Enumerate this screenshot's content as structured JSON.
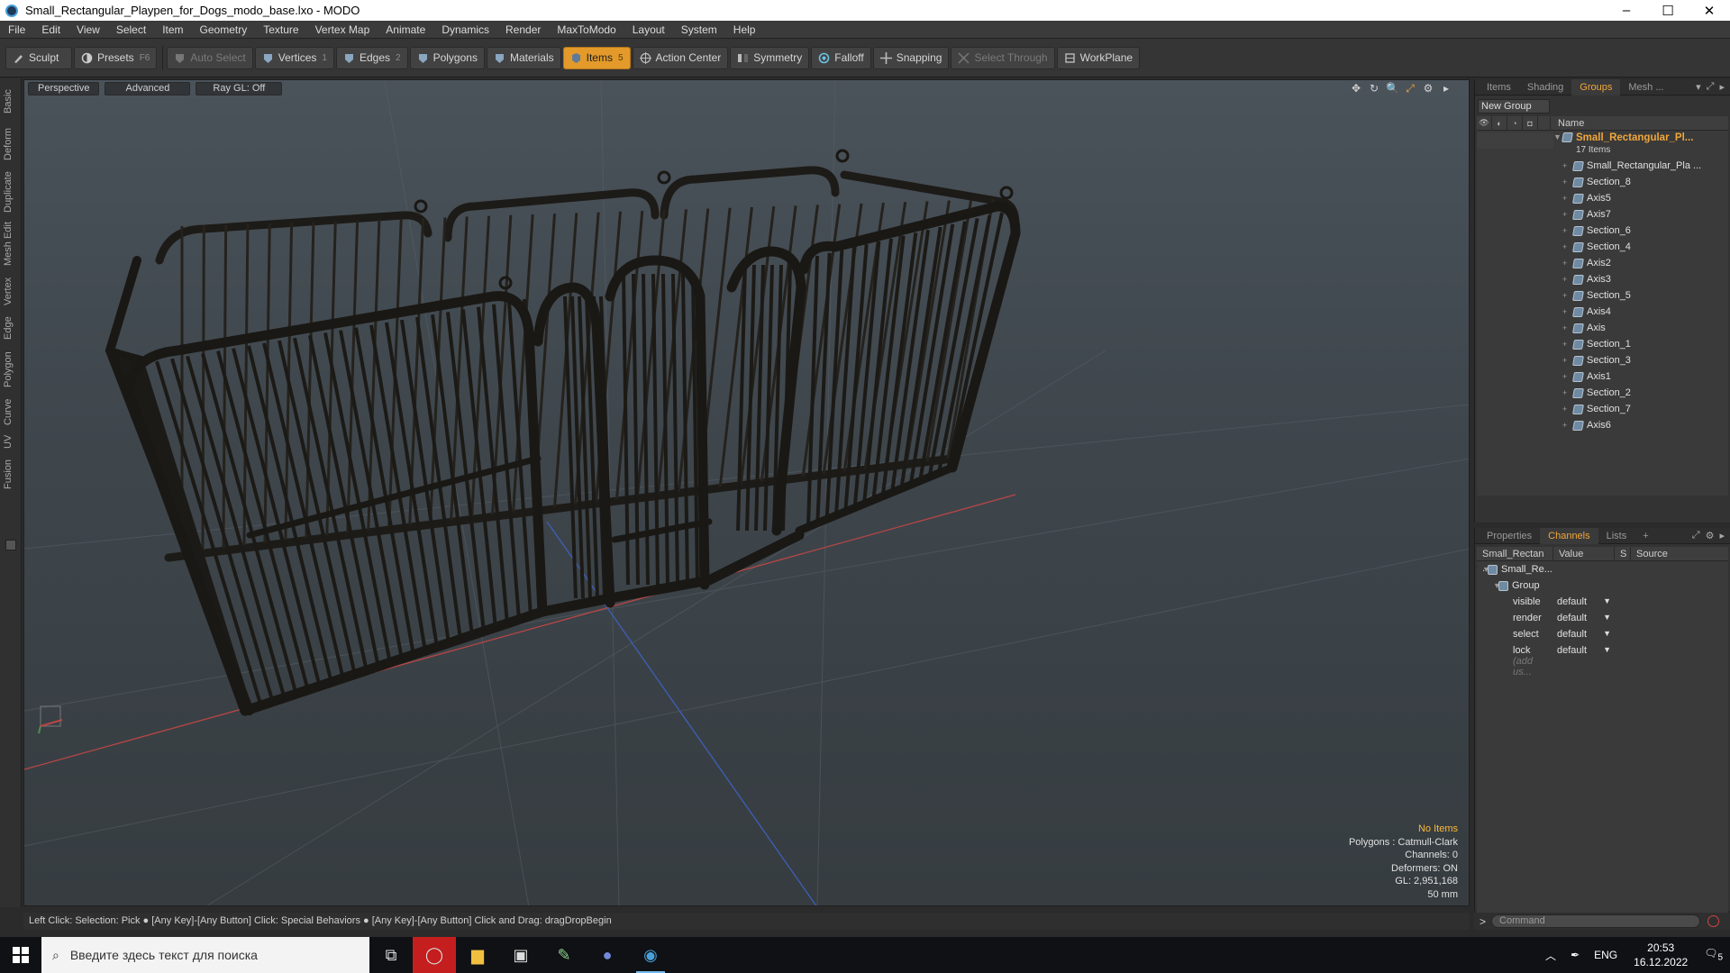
{
  "window": {
    "title": "Small_Rectangular_Playpen_for_Dogs_modo_base.lxo - MODO",
    "controls": [
      "–",
      "☐",
      "✕"
    ]
  },
  "menu": [
    "File",
    "Edit",
    "View",
    "Select",
    "Item",
    "Geometry",
    "Texture",
    "Vertex Map",
    "Animate",
    "Dynamics",
    "Render",
    "MaxToModo",
    "Layout",
    "System",
    "Help"
  ],
  "toolbar": {
    "sculpt": "Sculpt",
    "presets": "Presets",
    "presets_key": "F6",
    "auto_select": "Auto Select",
    "vertices": "Vertices",
    "vertices_key": "1",
    "edges": "Edges",
    "edges_key": "2",
    "polygons": "Polygons",
    "materials": "Materials",
    "items": "Items",
    "items_key": "5",
    "action_center": "Action Center",
    "symmetry": "Symmetry",
    "falloff": "Falloff",
    "snapping": "Snapping",
    "select_through": "Select Through",
    "workplane": "WorkPlane"
  },
  "left_tabs": [
    "Basic",
    "Deform",
    "Duplicate",
    "Mesh Edit",
    "Vertex",
    "Edge",
    "Polygon",
    "Curve",
    "UV",
    "Fusion"
  ],
  "viewport": {
    "view": "Perspective",
    "shading": "Advanced",
    "raygl": "Ray GL: Off",
    "tools": [
      "✥",
      "↻",
      "🔍",
      "⤢",
      "⚙",
      "▸"
    ],
    "info": {
      "selection": "No Items",
      "polygons": "Polygons : Catmull-Clark",
      "channels": "Channels: 0",
      "deformers": "Deformers: ON",
      "gl": "GL: 2,951,168",
      "size": "50 mm"
    }
  },
  "status": "Left Click: Selection: Pick ● [Any Key]-[Any Button] Click: Special Behaviors ● [Any Key]-[Any Button] Click and Drag: dragDropBegin",
  "items_panel": {
    "tabs": [
      "Items",
      "Shading",
      "Groups",
      "Mesh ..."
    ],
    "active_tab": "Groups",
    "new_group": "New Group",
    "col_name": "Name",
    "root_name": "Small_Rectangular_Pl...",
    "root_count": "17 Items",
    "children": [
      {
        "name": "Small_Rectangular_Pla ...",
        "type": "mesh"
      },
      {
        "name": "Section_8",
        "type": "mesh"
      },
      {
        "name": "Axis5",
        "type": "mesh"
      },
      {
        "name": "Axis7",
        "type": "mesh"
      },
      {
        "name": "Section_6",
        "type": "mesh"
      },
      {
        "name": "Section_4",
        "type": "mesh"
      },
      {
        "name": "Axis2",
        "type": "mesh"
      },
      {
        "name": "Axis3",
        "type": "mesh"
      },
      {
        "name": "Section_5",
        "type": "mesh"
      },
      {
        "name": "Axis4",
        "type": "mesh"
      },
      {
        "name": "Axis",
        "type": "mesh"
      },
      {
        "name": "Section_1",
        "type": "mesh"
      },
      {
        "name": "Section_3",
        "type": "mesh"
      },
      {
        "name": "Axis1",
        "type": "mesh"
      },
      {
        "name": "Section_2",
        "type": "mesh"
      },
      {
        "name": "Section_7",
        "type": "mesh"
      },
      {
        "name": "Axis6",
        "type": "mesh"
      }
    ]
  },
  "channels_panel": {
    "tabs": [
      "Properties",
      "Channels",
      "Lists",
      "+"
    ],
    "active_tab": "Channels",
    "col_item": "Small_Rectan ...",
    "col_value": "Value",
    "col_s": "S",
    "col_source": "Source",
    "item_name": "Small_Re...",
    "group_label": "Group",
    "rows": [
      {
        "name": "visible",
        "value": "default"
      },
      {
        "name": "render",
        "value": "default"
      },
      {
        "name": "select",
        "value": "default"
      },
      {
        "name": "lock",
        "value": "default"
      }
    ],
    "add_user": "(add us..."
  },
  "command": {
    "prompt": ">",
    "placeholder": "Command"
  },
  "taskbar": {
    "search_placeholder": "Введите здесь текст для поиска",
    "lang": "ENG",
    "time": "20:53",
    "date": "16.12.2022",
    "notifications": "5"
  },
  "colors": {
    "accent": "#e39a2a",
    "active_tab": "#f0a73a",
    "warning": "#ffb83a"
  }
}
